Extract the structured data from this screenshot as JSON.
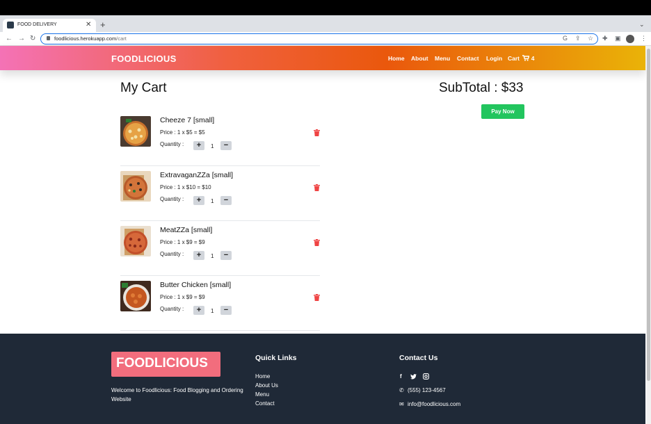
{
  "browser": {
    "tab_title": "FOOD DELIVERY",
    "url_host": "foodlicious.herokuapp.com",
    "url_path": "/cart"
  },
  "navbar": {
    "brand": "FOODLICIOUS",
    "links": [
      "Home",
      "About",
      "Menu",
      "Contact",
      "Login"
    ],
    "cart_label": "Cart",
    "cart_count": "4"
  },
  "cart": {
    "title": "My Cart",
    "subtotal": "SubTotal : $33",
    "pay_label": "Pay Now",
    "quantity_label": "Quantity :",
    "items": [
      {
        "name": "Cheeze 7 [small]",
        "price": "Price : 1 x $5 = $5",
        "qty": "1"
      },
      {
        "name": "ExtravaganZZa [small]",
        "price": "Price : 1 x $10 = $10",
        "qty": "1"
      },
      {
        "name": "MeatZZa [small]",
        "price": "Price : 1 x $9 = $9",
        "qty": "1"
      },
      {
        "name": "Butter Chicken [small]",
        "price": "Price : 1 x $9 = $9",
        "qty": "1"
      }
    ]
  },
  "footer": {
    "brand": "FOODLICIOUS",
    "tagline": "Welcome to Foodlicious: Food Blogging and Ordering Website",
    "quick_links_title": "Quick Links",
    "quick_links": [
      "Home",
      "About Us",
      "Menu",
      "Contact"
    ],
    "contact_title": "Contact Us",
    "phone": "(555) 123-4567",
    "email": "info@foodlicious.com"
  },
  "colors": {
    "pay_button": "#22c55e",
    "trash": "#ef4444",
    "footer_bg": "#1f2937",
    "footer_brand_bg": "#f26d7d"
  }
}
